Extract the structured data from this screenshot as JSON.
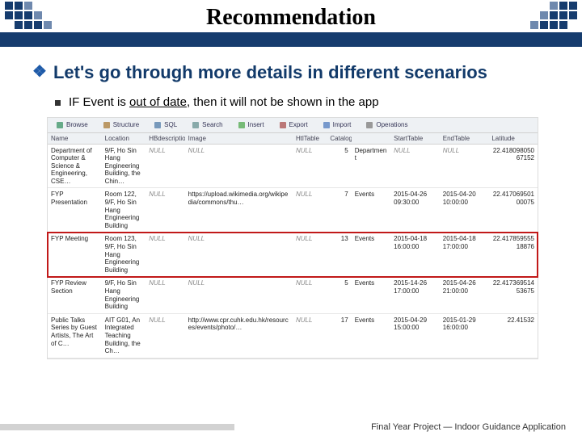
{
  "title": "Recommendation",
  "bullet1": "Let's go through more details in different scenarios",
  "bullet2_pre": "IF Event is ",
  "bullet2_under": "out of date",
  "bullet2_post": ", then it will not be shown in the app",
  "tabs": [
    {
      "icon": "browse-icon",
      "label": "Browse"
    },
    {
      "icon": "structure-icon",
      "label": "Structure"
    },
    {
      "icon": "sql-icon",
      "label": "SQL"
    },
    {
      "icon": "search-icon",
      "label": "Search"
    },
    {
      "icon": "insert-icon",
      "label": "Insert"
    },
    {
      "icon": "export-icon",
      "label": "Export"
    },
    {
      "icon": "import-icon",
      "label": "Import"
    },
    {
      "icon": "operations-icon",
      "label": "Operations"
    }
  ],
  "columns": [
    "Name",
    "Location",
    "HBdescription",
    "Image",
    "HtlTable",
    "Catalog",
    "",
    "StartTable",
    "EndTable",
    "Latitude"
  ],
  "colwidths": [
    "11%",
    "9%",
    "8%",
    "22%",
    "7%",
    "5%",
    "8%",
    "10%",
    "10%",
    "10%"
  ],
  "rows": [
    {
      "name": "Department of Computer & Science & Engineering, CSE…",
      "loc": "9/F, Ho Sin Hang Engineering Building, the Chin…",
      "hb": "NULL",
      "image": "NULL",
      "ht": "NULL",
      "cat_a": "5",
      "cat_b": "Department",
      "s": "NULL",
      "e": "NULL",
      "lat": "22.41809805067152"
    },
    {
      "name": "FYP Presentation",
      "loc": "Room 122, 9/F, Ho Sin Hang Engineering Building",
      "hb": "NULL",
      "image": "https://upload.wikimedia.org/wikipedia/commons/thu…",
      "ht": "NULL",
      "cat_a": "7",
      "cat_b": "Events",
      "s": "2015-04-26 09:30:00",
      "e": "2015-04-20 10:00:00",
      "lat": "22.41706950100075"
    },
    {
      "name": "FYP Meeting",
      "loc": "Room 123, 9/F, Ho Sin Hang Engineering Building",
      "hb": "NULL",
      "image": "NULL",
      "ht": "NULL",
      "cat_a": "13",
      "cat_b": "Events",
      "s": "2015-04-18 16:00:00",
      "e": "2015-04-18 17:00:00",
      "lat": "22.41785955518876",
      "highlight": true
    },
    {
      "name": "FYP Review Section",
      "loc": "9/F, Ho Sin Hang Engineering Building",
      "hb": "NULL",
      "image": "NULL",
      "ht": "NULL",
      "cat_a": "5",
      "cat_b": "Events",
      "s": "2015-14-26 17:00:00",
      "e": "2015-04-26 21:00:00",
      "lat": "22.41736951453675"
    },
    {
      "name": "Public Talks Series by Guest Artists, The Art of C…",
      "loc": "AIT G01, An Integrated Teaching Building, the Ch…",
      "hb": "NULL",
      "image": "http://www.cpr.cuhk.edu.hk/resources/events/photo/…",
      "ht": "NULL",
      "cat_a": "17",
      "cat_b": "Events",
      "s": "2015-04-29 15:00:00",
      "e": "2015-01-29 16:00:00",
      "lat": "22.41532"
    }
  ],
  "footer": "Final Year Project — Indoor Guidance Application"
}
